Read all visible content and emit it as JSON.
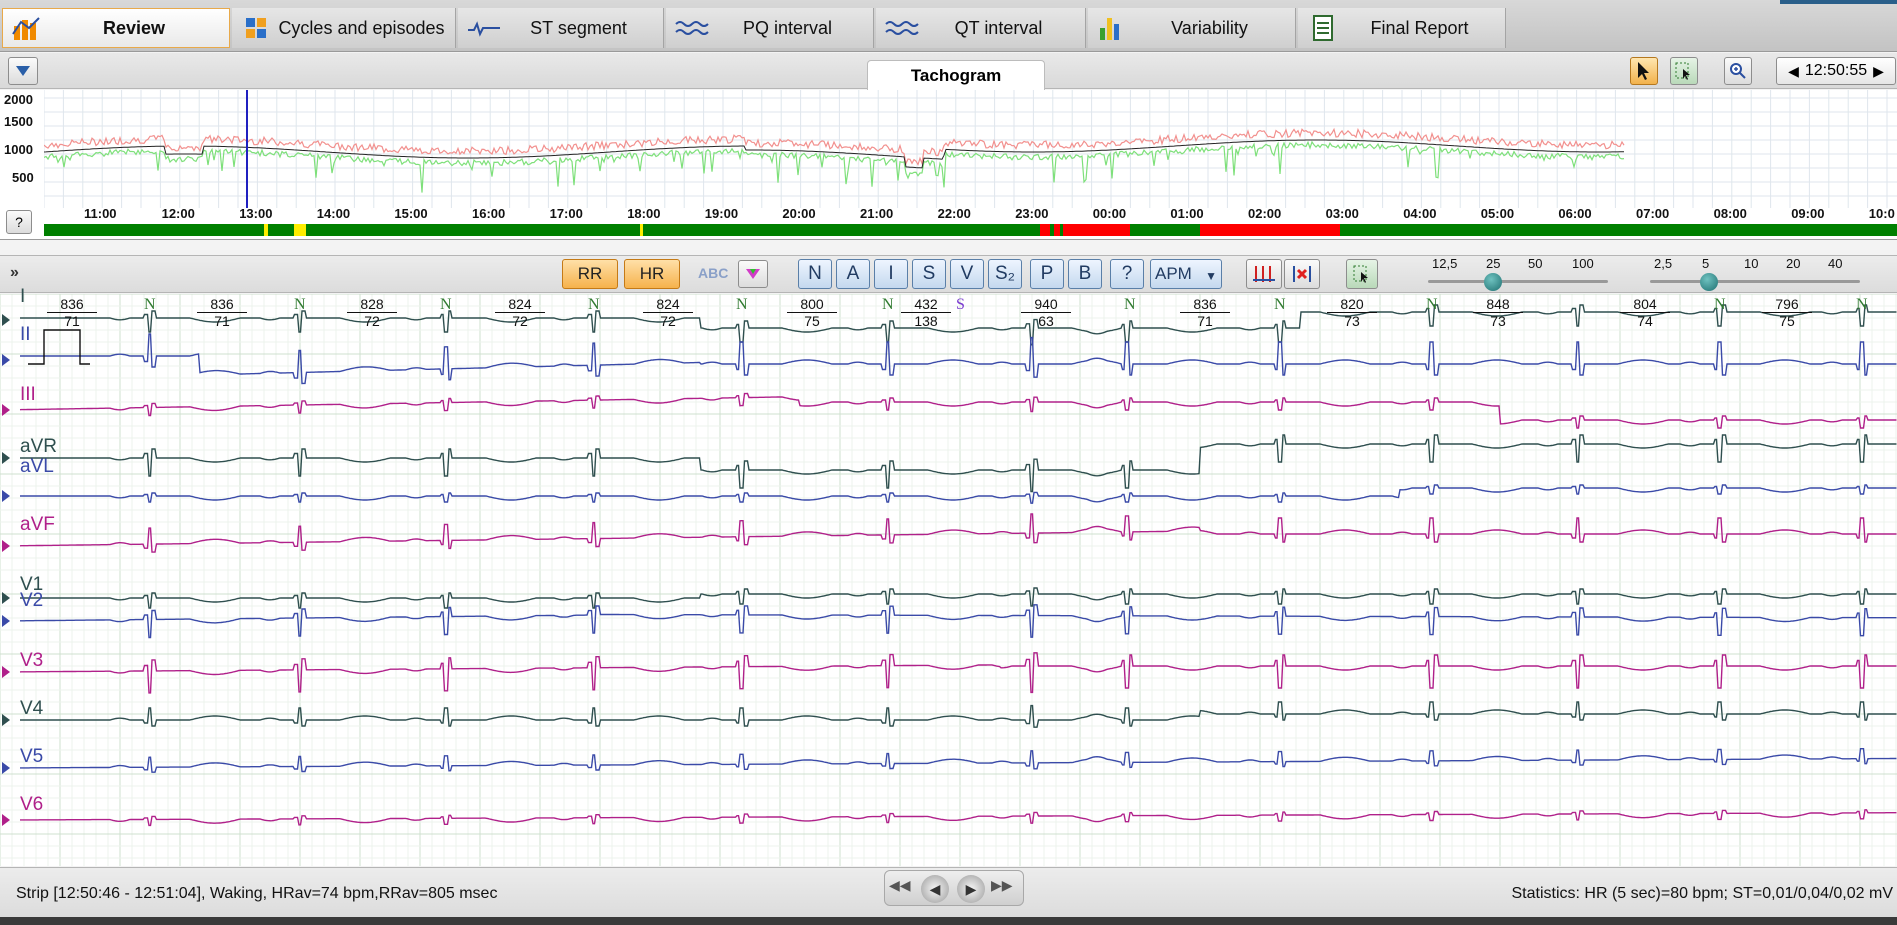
{
  "top_tabs": [
    {
      "label": "Review",
      "icon": "bar-chart-icon",
      "active": true
    },
    {
      "label": "Cycles and episodes",
      "icon": "grid-icon"
    },
    {
      "label": "ST segment",
      "icon": "st-wave-icon"
    },
    {
      "label": "PQ interval",
      "icon": "pq-wave-icon"
    },
    {
      "label": "QT interval",
      "icon": "qt-wave-icon"
    },
    {
      "label": "Variability",
      "icon": "variability-chart-icon"
    },
    {
      "label": "Final Report",
      "icon": "report-icon"
    }
  ],
  "tachogram": {
    "tab_label": "Tachogram",
    "time_display": "12:50:55",
    "y_ticks": [
      "2000",
      "1500",
      "1000",
      "500"
    ],
    "x_ticks": [
      "11:00",
      "12:00",
      "13:00",
      "14:00",
      "15:00",
      "16:00",
      "17:00",
      "18:00",
      "19:00",
      "20:00",
      "21:00",
      "22:00",
      "23:00",
      "00:00",
      "01:00",
      "02:00",
      "03:00",
      "04:00",
      "05:00",
      "06:00",
      "07:00",
      "08:00",
      "09:00",
      "10:0"
    ],
    "help_label": "?"
  },
  "ecg_toolbar": {
    "rr_label": "RR",
    "hr_label": "HR",
    "abc_label": "ABC",
    "beat_buttons": [
      "N",
      "A",
      "I",
      "S",
      "V",
      "S₂",
      "P",
      "B",
      "?"
    ],
    "apm_label": "APM",
    "speed_scale": [
      "12,5",
      "25",
      "50",
      "100"
    ],
    "speed_value": "25",
    "gain_scale": [
      "2,5",
      "5",
      "10",
      "20",
      "40"
    ],
    "gain_value": "5"
  },
  "ecg": {
    "leads": [
      {
        "name": "I",
        "color": "#2f4f4f"
      },
      {
        "name": "II",
        "color": "#3a4aa8"
      },
      {
        "name": "III",
        "color": "#b0208a"
      },
      {
        "name": "aVR",
        "color": "#2f4f4f"
      },
      {
        "name": "aVL",
        "color": "#3a4aa8"
      },
      {
        "name": "aVF",
        "color": "#b0208a"
      },
      {
        "name": "V1",
        "color": "#2f4f4f"
      },
      {
        "name": "V2",
        "color": "#3a4aa8"
      },
      {
        "name": "V3",
        "color": "#b0208a"
      },
      {
        "name": "V4",
        "color": "#2f4f4f"
      },
      {
        "name": "V5",
        "color": "#3a4aa8"
      },
      {
        "name": "V6",
        "color": "#b0208a"
      }
    ],
    "intervals": [
      {
        "rr": "836",
        "hr": "71"
      },
      {
        "rr": "836",
        "hr": "71"
      },
      {
        "rr": "828",
        "hr": "72"
      },
      {
        "rr": "824",
        "hr": "72"
      },
      {
        "rr": "824",
        "hr": "72"
      },
      {
        "rr": "800",
        "hr": "75"
      },
      {
        "rr": "432",
        "hr": "138"
      },
      {
        "rr": "940",
        "hr": "63"
      },
      {
        "rr": "836",
        "hr": "71"
      },
      {
        "rr": "820",
        "hr": "73"
      },
      {
        "rr": "848",
        "hr": "73"
      },
      {
        "rr": "804",
        "hr": "74"
      },
      {
        "rr": "796",
        "hr": "75"
      }
    ],
    "beat_labels": [
      "N",
      "N",
      "N",
      "N",
      "N",
      "N",
      "S",
      "N",
      "N",
      "N",
      "N",
      "N"
    ]
  },
  "status": {
    "left": "Strip [12:50:46 - 12:51:04], Waking,  HRav=74 bpm,RRav=805 msec",
    "right": "Statistics: HR (5 sec)=80 bpm; ST=0,01/0,04/0,02 mV"
  }
}
